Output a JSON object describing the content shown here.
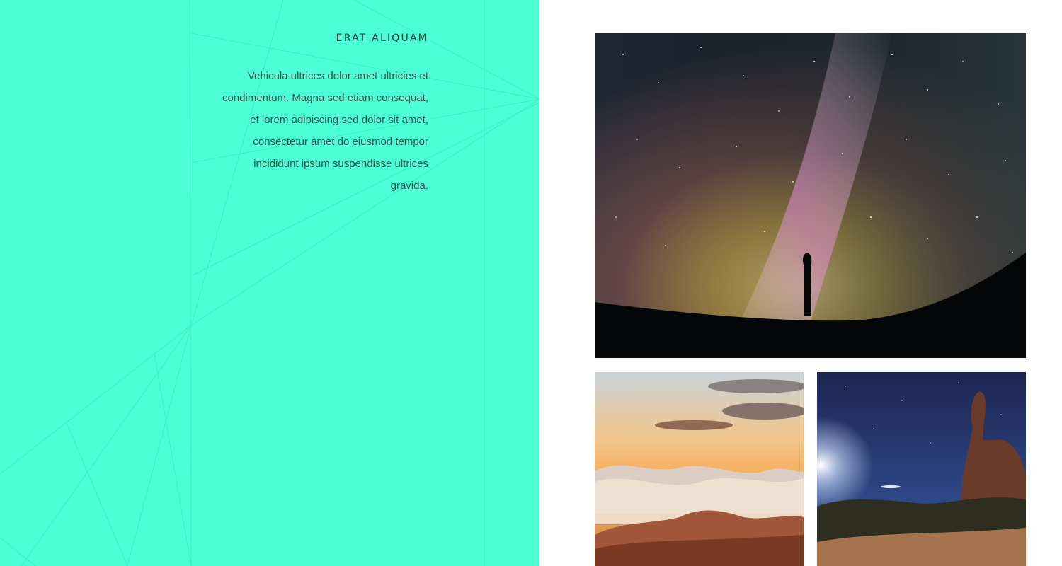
{
  "section": {
    "heading": "ERAT ALIQUAM",
    "body": "Vehicula ultrices dolor amet ultricies et condimentum. Magna sed etiam consequat, et lorem adipiscing sed dolor sit amet, consectetur amet do eiusmod tempor incididunt ipsum suspendisse ultrices gravida."
  },
  "colors": {
    "panel_background": "#4dffd6",
    "heading_text": "#1f3b36",
    "body_text": "#35524c",
    "page_background": "#ffffff"
  },
  "gallery": {
    "images": [
      {
        "name": "milky-way-silhouette-image"
      },
      {
        "name": "sunset-mountain-clouds-image"
      },
      {
        "name": "night-rock-arch-image"
      }
    ]
  }
}
